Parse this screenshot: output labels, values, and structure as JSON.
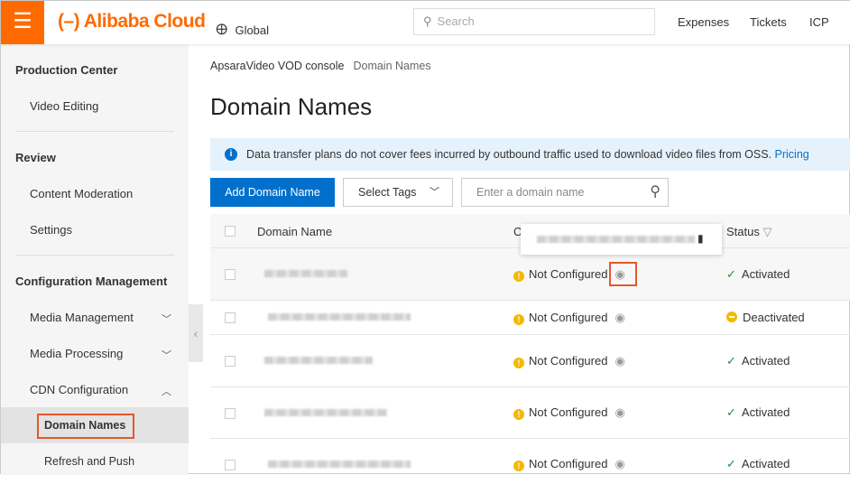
{
  "header": {
    "menu_icon": "hamburger-icon",
    "logo": "Alibaba Cloud",
    "region": "Global",
    "search_placeholder": "Search",
    "nav": [
      "Expenses",
      "Tickets",
      "ICP"
    ]
  },
  "sidebar": {
    "sections": [
      {
        "title": "Production Center",
        "items": [
          {
            "label": "Video Editing"
          }
        ]
      },
      {
        "title": "Review",
        "items": [
          {
            "label": "Content Moderation"
          },
          {
            "label": "Settings"
          }
        ]
      },
      {
        "title": "Configuration Management",
        "items": [
          {
            "label": "Media Management",
            "chevron": "down"
          },
          {
            "label": "Media Processing",
            "chevron": "down"
          },
          {
            "label": "CDN Configuration",
            "chevron": "up"
          }
        ],
        "subitems": [
          {
            "label": "Domain Names",
            "selected": true
          },
          {
            "label": "Refresh and Push"
          }
        ]
      }
    ]
  },
  "breadcrumb": [
    "ApsaraVideo VOD console",
    "Domain Names"
  ],
  "page_title": "Domain Names",
  "notice": {
    "text": "Data transfer plans do not cover fees incurred by outbound traffic used to download video files from OSS.",
    "link": "Pricing"
  },
  "toolbar": {
    "add": "Add Domain Name",
    "tags": "Select Tags",
    "search_placeholder": "Enter a domain name"
  },
  "table": {
    "columns": [
      "Domain Name",
      "C",
      "Status"
    ],
    "rows": [
      {
        "cname": "Not Configured",
        "status": "Activated"
      },
      {
        "cname": "Not Configured",
        "status": "Deactivated"
      },
      {
        "cname": "Not Configured",
        "status": "Activated"
      },
      {
        "cname": "Not Configured",
        "status": "Activated"
      },
      {
        "cname": "Not Configured",
        "status": "Activated"
      }
    ]
  },
  "colors": {
    "brand": "#ff6a00",
    "primary": "#0070cc",
    "highlight": "#e4572e",
    "warning": "#f5b800",
    "success": "#1e8e3e"
  }
}
